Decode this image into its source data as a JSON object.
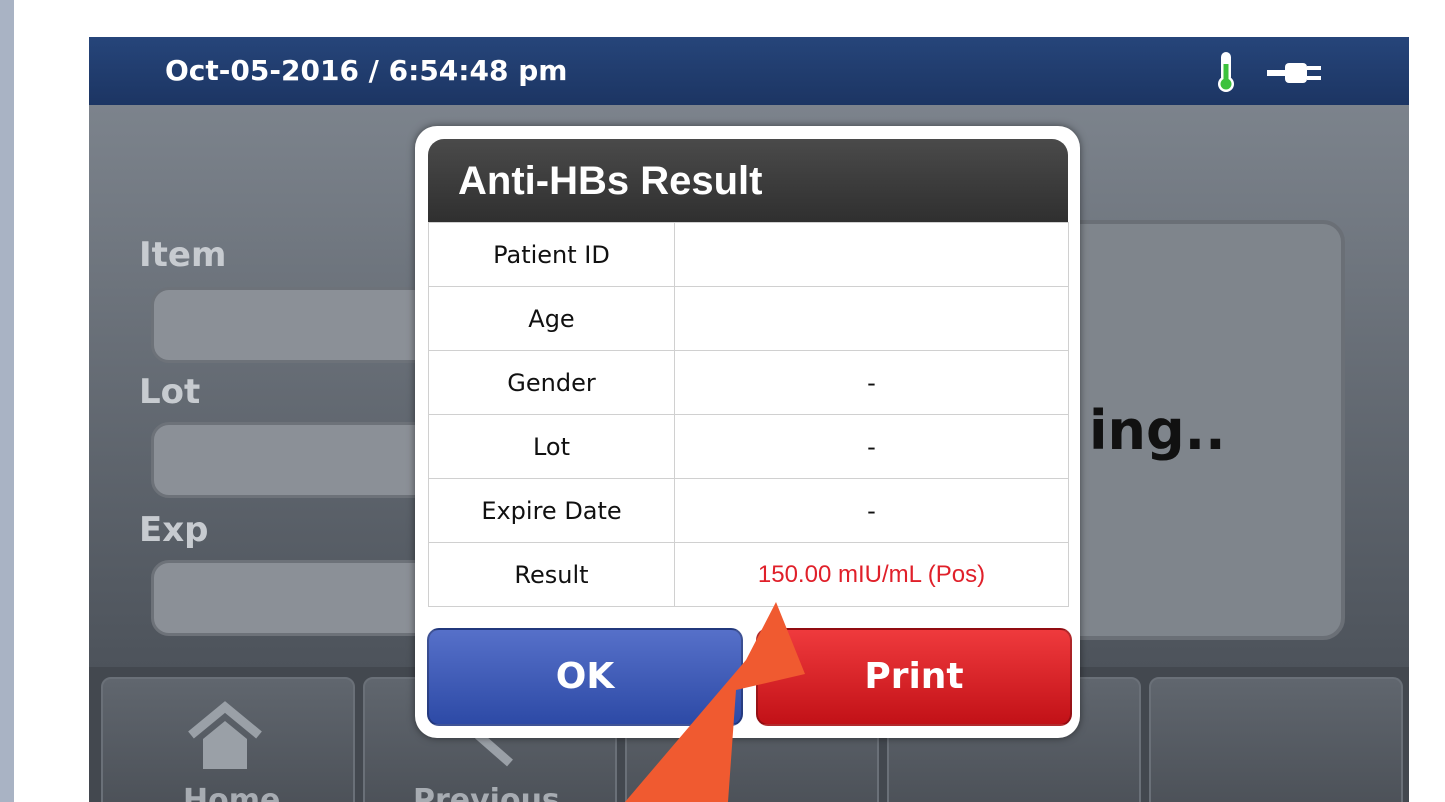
{
  "status_bar": {
    "datetime": "Oct-05-2016 / 6:54:48 pm",
    "icons": [
      "thermometer-icon",
      "power-plug-icon"
    ]
  },
  "background_form": {
    "item_label": "Item",
    "lot_label": "Lot",
    "exp_label": "Exp",
    "status_text": "ing.."
  },
  "nav": {
    "home_label": "Home",
    "previous_label": "Previous"
  },
  "dialog": {
    "title": "Anti-HBs Result",
    "rows": [
      {
        "label": "Patient ID",
        "value": ""
      },
      {
        "label": "Age",
        "value": ""
      },
      {
        "label": "Gender",
        "value": "-"
      },
      {
        "label": "Lot",
        "value": "-"
      },
      {
        "label": "Expire Date",
        "value": "-"
      },
      {
        "label": "Result",
        "value": "150.00 mIU/mL (Pos)"
      }
    ],
    "ok_label": "OK",
    "print_label": "Print"
  },
  "colors": {
    "result_value": "#e0202a",
    "annotation_arrow": "#f05a30",
    "ok_button": "#3b58b8",
    "print_button": "#d8171d"
  }
}
